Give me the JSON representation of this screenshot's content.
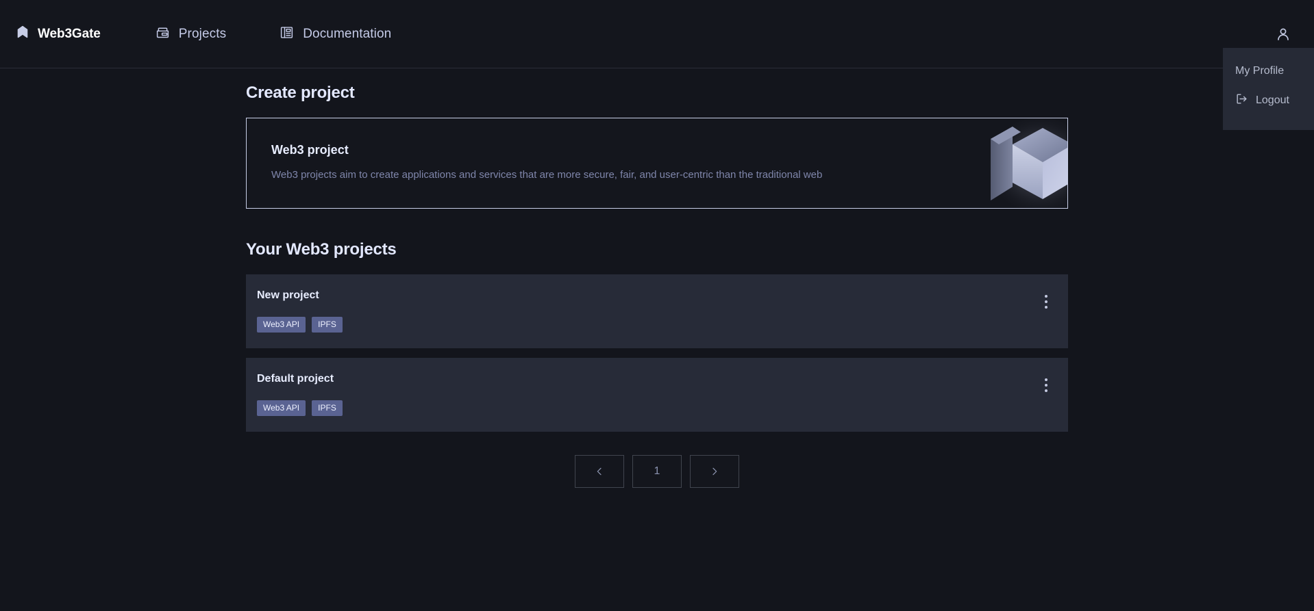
{
  "header": {
    "brand": {
      "name": "Web3Gate",
      "icon": "bookmark-logo-icon"
    },
    "nav": [
      {
        "label": "Projects",
        "icon": "wallet-icon"
      },
      {
        "label": "Documentation",
        "icon": "book-icon"
      }
    ],
    "avatar_icon": "user-avatar-icon"
  },
  "profile_menu": {
    "open": true,
    "items": [
      {
        "label": "My Profile",
        "icon": null
      },
      {
        "label": "Logout",
        "icon": "logout-arrow-icon"
      }
    ]
  },
  "main": {
    "create_section": {
      "title": "Create project",
      "card": {
        "title": "Web3 project",
        "description": "Web3 projects aim to create applications and services that are more secure, fair, and user-centric than the traditional web",
        "illustration": "3d-cube-icon"
      }
    },
    "projects_section": {
      "title": "Your Web3 projects",
      "projects": [
        {
          "name": "New project",
          "tags": [
            "Web3 API",
            "IPFS"
          ],
          "menu_icon": "kebab-menu-icon"
        },
        {
          "name": "Default project",
          "tags": [
            "Web3 API",
            "IPFS"
          ],
          "menu_icon": "kebab-menu-icon"
        }
      ]
    },
    "pagination": {
      "prev_icon": "chevron-left-icon",
      "next_icon": "chevron-right-icon",
      "pages": [
        "1"
      ],
      "current_page": "1"
    }
  },
  "colors": {
    "background": "#13151c",
    "header_bg": "#14161d",
    "card_bg": "#272b38",
    "dropdown_bg": "#262a36",
    "tag_bg": "#5a6392",
    "accent_border": "#c9cfe8",
    "text_primary": "#e8edff",
    "text_muted": "#7f86ab"
  }
}
